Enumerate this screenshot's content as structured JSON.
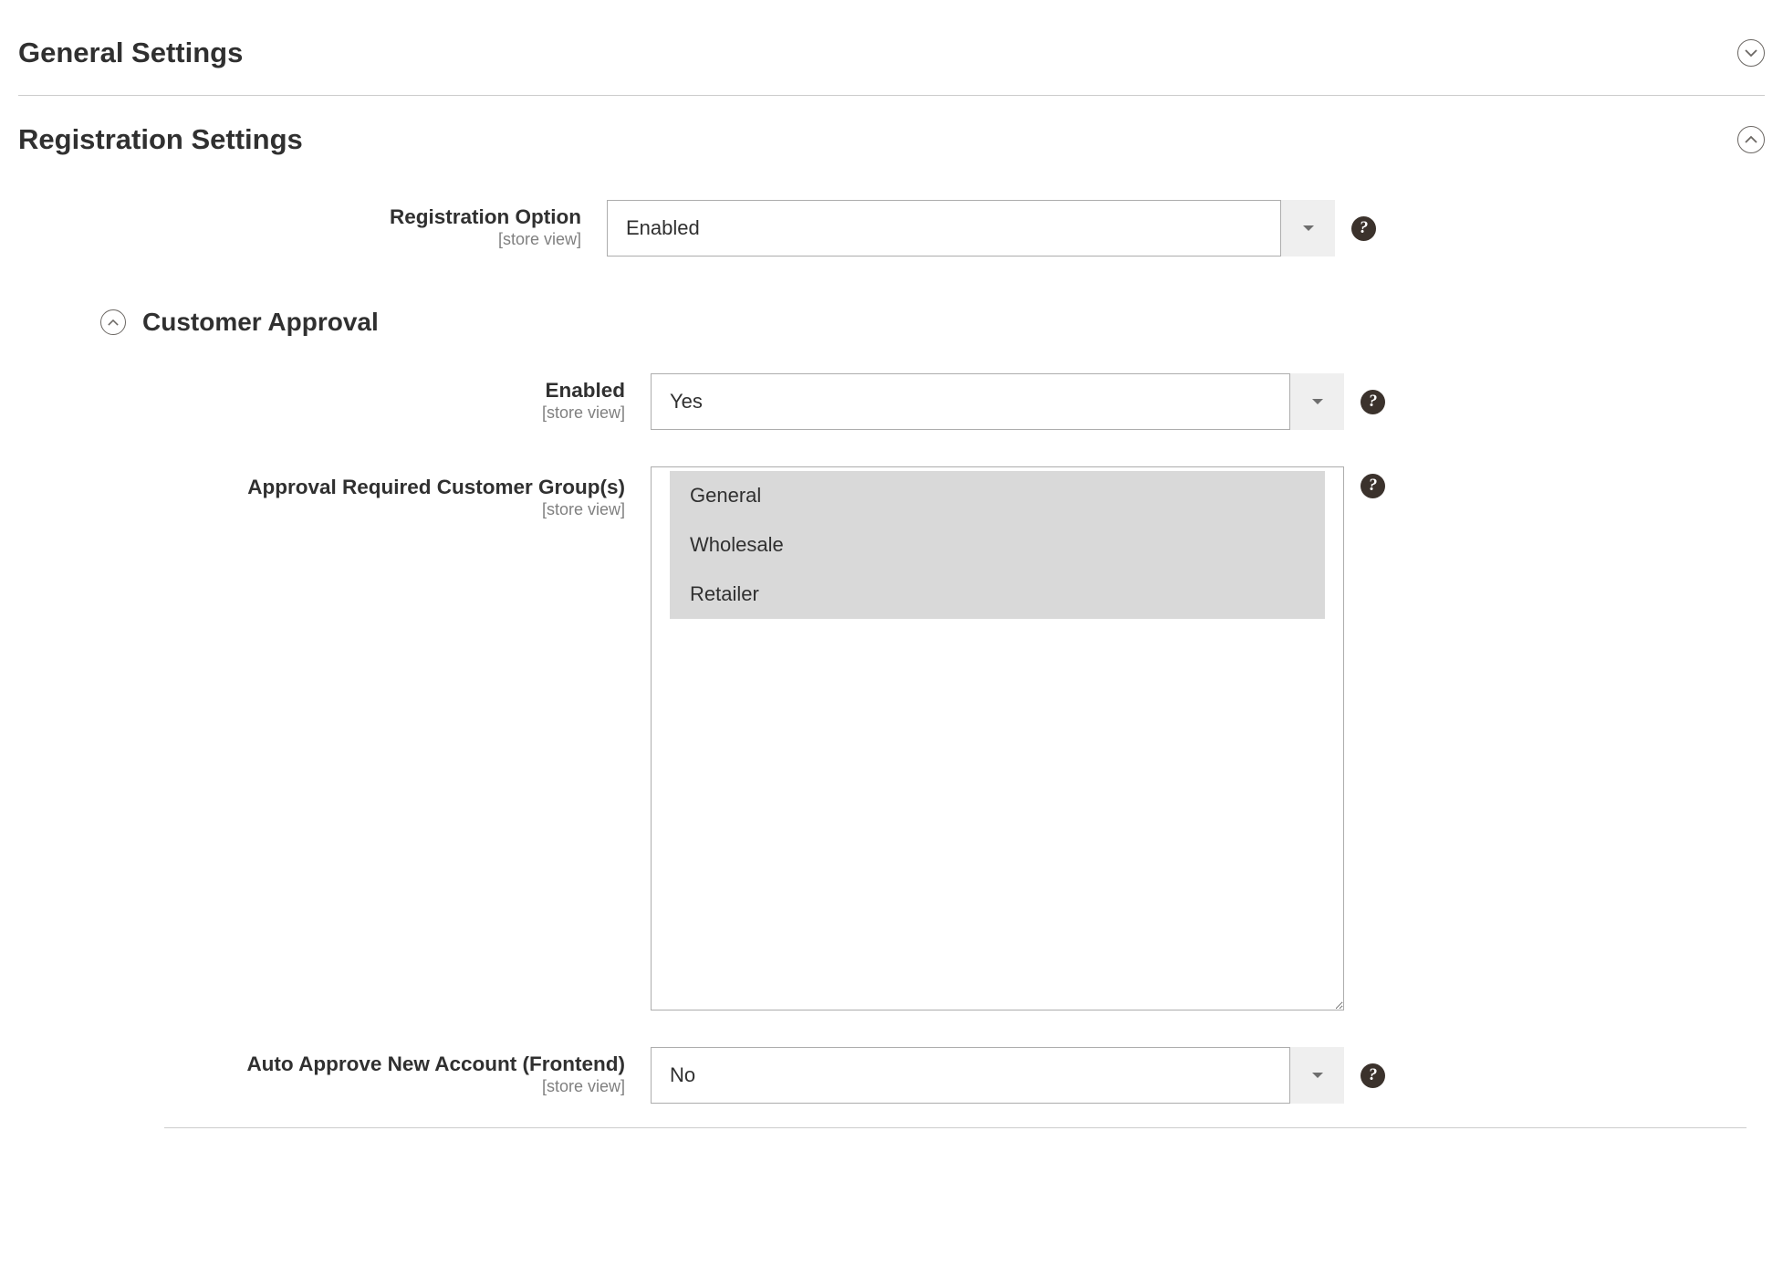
{
  "sections": {
    "general": {
      "title": "General Settings",
      "expanded": false
    },
    "registration": {
      "title": "Registration Settings",
      "expanded": true,
      "fields": {
        "registration_option": {
          "label": "Registration Option",
          "scope": "[store view]",
          "value": "Enabled"
        }
      },
      "customer_approval": {
        "title": "Customer Approval",
        "expanded": true,
        "fields": {
          "enabled": {
            "label": "Enabled",
            "scope": "[store view]",
            "value": "Yes"
          },
          "approval_required_groups": {
            "label": "Approval Required Customer Group(s)",
            "scope": "[store view]",
            "options": [
              "General",
              "Wholesale",
              "Retailer"
            ],
            "selected": [
              "General",
              "Wholesale",
              "Retailer"
            ]
          },
          "auto_approve": {
            "label": "Auto Approve New Account (Frontend)",
            "scope": "[store view]",
            "value": "No"
          }
        }
      }
    }
  },
  "help_glyph": "?"
}
